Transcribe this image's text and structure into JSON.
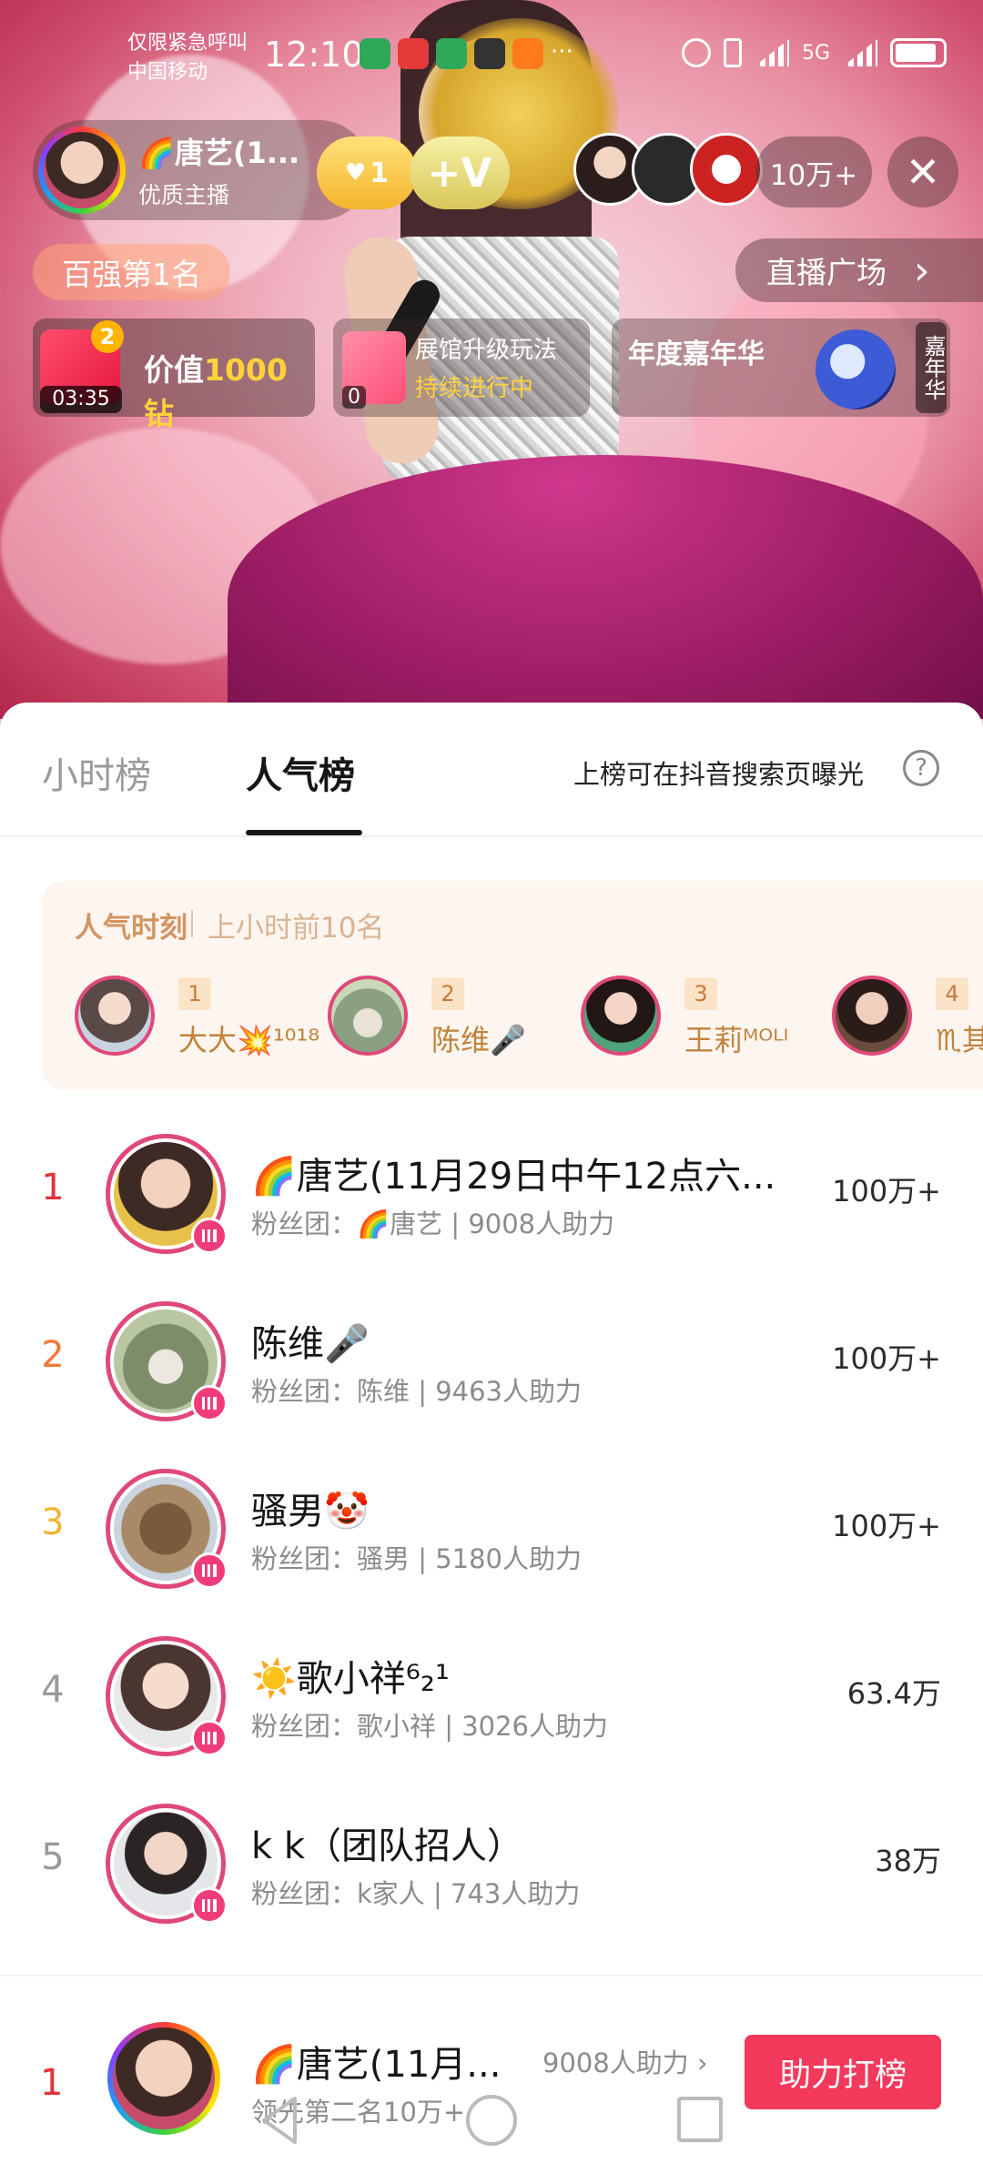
{
  "status_bar": {
    "carrier_line1": "仅限紧急呼叫",
    "carrier_line2": "中国移动",
    "time": "12:10",
    "dots": "···",
    "network": "5G"
  },
  "live_header": {
    "host_name": "🌈唐艺(1...",
    "host_tag": "优质主播",
    "fan_level": "1",
    "vip_mark": "+V",
    "audience_count": "10万+",
    "rank_tag": "百强第1名",
    "plaza_label": "直播广场",
    "plaza_arrow": "›"
  },
  "promo_cards": {
    "gift_badge": "2",
    "gift_timer": "03:35",
    "gift_prefix": "价值",
    "gift_value": "1000钻",
    "upgrade_line1": "展馆升级玩法",
    "upgrade_line2": "持续进行中",
    "upgrade_timer": "0",
    "carnival_title": "年度嘉年华",
    "carnival_side": "嘉年华"
  },
  "tabs": {
    "hourly": "小时榜",
    "popularity": "人气榜",
    "expose_note": "上榜可在抖音搜索页曝光",
    "help": "?"
  },
  "popular_moment": {
    "title": "人气时刻",
    "subtitle": "上小时前10名",
    "items": [
      {
        "rank": "1",
        "name": "大大💥¹⁰¹⁸"
      },
      {
        "rank": "2",
        "name": "陈维🎤"
      },
      {
        "rank": "3",
        "name": "王莉ᴹᴼᴸᴵ"
      },
      {
        "rank": "4",
        "name": "♏其"
      }
    ]
  },
  "ranking": [
    {
      "rank": "1",
      "name": "🌈唐艺(11月29日中午12点六...",
      "fan_club": "粉丝团：🌈唐艺 | 9008人助力",
      "score": "100万+",
      "rank_color": "#e0343a"
    },
    {
      "rank": "2",
      "name": "陈维🎤",
      "fan_club": "粉丝团：陈维 | 9463人助力",
      "score": "100万+",
      "rank_color": "#ef7a3c"
    },
    {
      "rank": "3",
      "name": "骚男🤡",
      "fan_club": "粉丝团：骚男 | 5180人助力",
      "score": "100万+",
      "rank_color": "#f2b531"
    },
    {
      "rank": "4",
      "name": "☀️歌小祥⁶₂¹",
      "fan_club": "粉丝团：歌小祥 | 3026人助力",
      "score": "63.4万",
      "rank_color": "#9a9a9a"
    },
    {
      "rank": "5",
      "name": "k k（团队招人）",
      "fan_club": "粉丝团：k家人 | 743人助力",
      "score": "38万",
      "rank_color": "#9a9a9a"
    }
  ],
  "footer": {
    "rank": "1",
    "name": "🌈唐艺(11月...",
    "boost": "9008人助力 ›",
    "lead_text": "领先第二名10万+",
    "cta": "助力打榜"
  },
  "colors": {
    "accent": "#f33a5c",
    "avatar_ring": "#e0487a",
    "moment_bg": "#fdf5ef"
  }
}
